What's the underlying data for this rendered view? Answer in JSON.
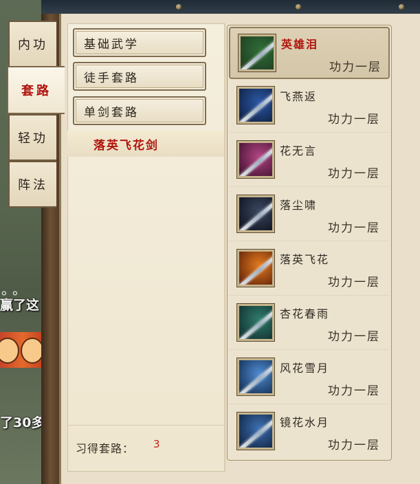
{
  "side_tabs": [
    {
      "label": "内功",
      "active": false
    },
    {
      "label": "套路",
      "active": true
    },
    {
      "label": "轻功",
      "active": false
    },
    {
      "label": "阵法",
      "active": false
    }
  ],
  "categories": [
    {
      "label": "基础武学"
    },
    {
      "label": "徒手套路"
    },
    {
      "label": "单剑套路"
    }
  ],
  "selected_subitem": "落英飞花剑",
  "footer": {
    "label": "习得套路：",
    "value": "3"
  },
  "skills": [
    {
      "name": "英雄泪",
      "level": "功力一层",
      "selected": true,
      "icon": "sword-green-icon",
      "colors": [
        "#1e3a22",
        "#2f6d37"
      ]
    },
    {
      "name": "飞燕返",
      "level": "功力一层",
      "selected": false,
      "icon": "sword-blue-icon",
      "colors": [
        "#0e1d3a",
        "#2a57a5"
      ]
    },
    {
      "name": "花无言",
      "level": "功力一层",
      "selected": false,
      "icon": "sword-pink-icon",
      "colors": [
        "#3a0f2a",
        "#b14583"
      ]
    },
    {
      "name": "落尘啸",
      "level": "功力一层",
      "selected": false,
      "icon": "sword-dark-icon",
      "colors": [
        "#0b0f1a",
        "#3a4760"
      ]
    },
    {
      "name": "落英飞花",
      "level": "功力一层",
      "selected": false,
      "icon": "sword-fire-icon",
      "colors": [
        "#5a1c08",
        "#e07a1e"
      ]
    },
    {
      "name": "杏花春雨",
      "level": "功力一层",
      "selected": false,
      "icon": "sword-teal-icon",
      "colors": [
        "#0f2a2a",
        "#2f7a6b"
      ]
    },
    {
      "name": "风花雪月",
      "level": "功力一层",
      "selected": false,
      "icon": "sword-ice-icon",
      "colors": [
        "#10284a",
        "#4d8ad0"
      ]
    },
    {
      "name": "镜花水月",
      "level": "功力一层",
      "selected": false,
      "icon": "sword-water-icon",
      "colors": [
        "#0d1f3a",
        "#3c6fb0"
      ]
    }
  ],
  "background_chat": {
    "dots": "。。",
    "line1": "赢了这",
    "line2": "了30多"
  }
}
